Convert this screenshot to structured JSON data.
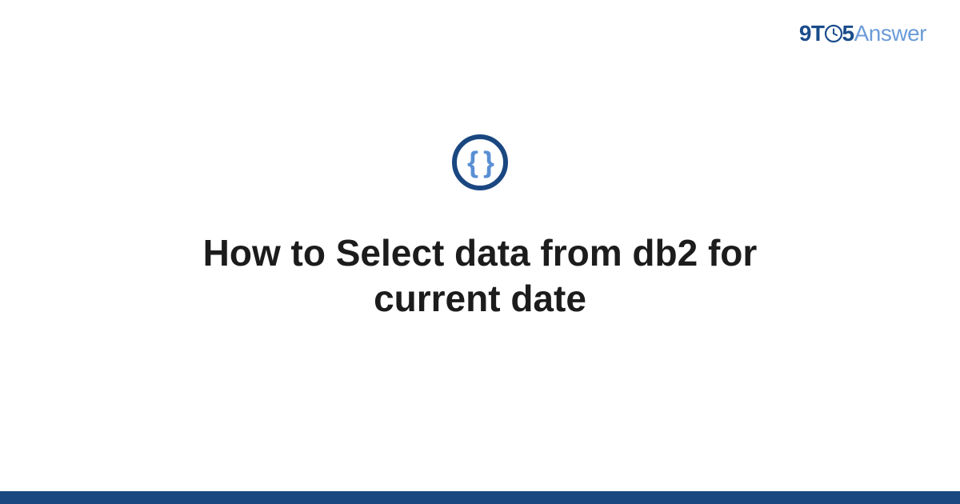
{
  "brand": {
    "prefix": "9T",
    "middle": "5",
    "suffix": "Answer"
  },
  "icon": {
    "glyph": "{ }",
    "semantic": "code-braces-icon"
  },
  "title": "How to Select data from db2 for current date",
  "colors": {
    "brandDark": "#1a4780",
    "brandLight": "#6b9bd8",
    "text": "#1c1c1c"
  }
}
